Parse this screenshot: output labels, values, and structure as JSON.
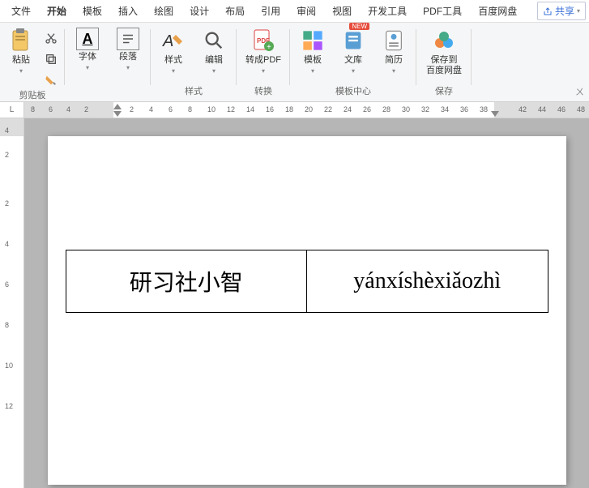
{
  "menu": {
    "tabs": [
      "文件",
      "开始",
      "模板",
      "插入",
      "绘图",
      "设计",
      "布局",
      "引用",
      "审阅",
      "视图",
      "开发工具",
      "PDF工具",
      "百度网盘"
    ],
    "active_index": 1,
    "share": "共享"
  },
  "ribbon": {
    "clipboard": {
      "paste": "粘贴",
      "group_label": "剪贴板"
    },
    "font": {
      "label": "字体"
    },
    "paragraph": {
      "label": "段落"
    },
    "styles": {
      "label": "样式",
      "group_label": "样式"
    },
    "editing": {
      "label": "编辑"
    },
    "convert": {
      "label": "转成PDF",
      "group_label": "转换"
    },
    "template_center": {
      "template": "模板",
      "wenku": "文库",
      "resume": "简历",
      "group_label": "模板中心",
      "new_badge": "NEW"
    },
    "save": {
      "label_line1": "保存到",
      "label_line2": "百度网盘",
      "group_label": "保存"
    }
  },
  "ruler_h": {
    "corner": "L",
    "left_nums": [
      "8",
      "6",
      "4",
      "2"
    ],
    "right_nums": [
      "2",
      "4",
      "6",
      "8",
      "10",
      "12",
      "14",
      "16",
      "18",
      "20",
      "22",
      "24",
      "26",
      "28",
      "30",
      "32",
      "34",
      "36",
      "38"
    ],
    "overflow_nums": [
      "42",
      "44",
      "46",
      "48"
    ]
  },
  "ruler_v": {
    "nums": [
      "4",
      "2",
      "2",
      "4",
      "6",
      "8",
      "10",
      "12"
    ]
  },
  "document": {
    "table": {
      "cells": [
        "研习社小智",
        "yánxíshèxiǎozhì"
      ]
    }
  }
}
